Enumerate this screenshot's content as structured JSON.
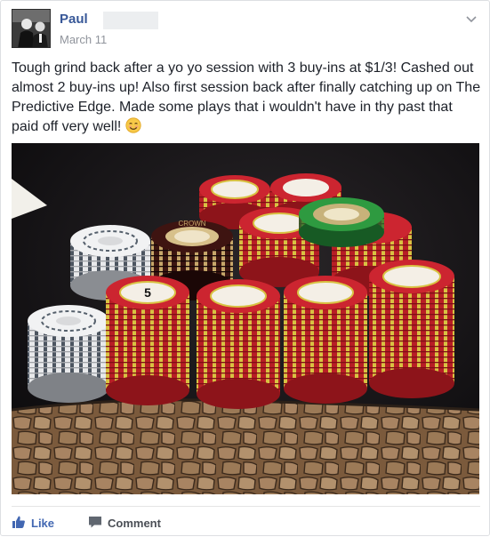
{
  "post": {
    "author": "Paul",
    "date": "March 11",
    "body": "Tough grind back after a yo yo session with 3 buy-ins at $1/3! Cashed out almost 2 buy-ins up! Also first session back after finally catching up on The Predictive Edge. Made some plays that i wouldn't have in thy past that paid off very well! ",
    "emoji": "smiling-face-emoji"
  },
  "actions": {
    "like_label": "Like",
    "comment_label": "Comment"
  },
  "colors": {
    "link_blue": "#385898",
    "like_blue": "#4267b2",
    "meta_gray": "#90949c",
    "text": "#1d2129",
    "felt": "#141315",
    "chip_red": "#c8222c",
    "chip_green": "#2e8b3e"
  },
  "photo": {
    "chip_text": "CROWN",
    "chip_denomination": "5"
  }
}
